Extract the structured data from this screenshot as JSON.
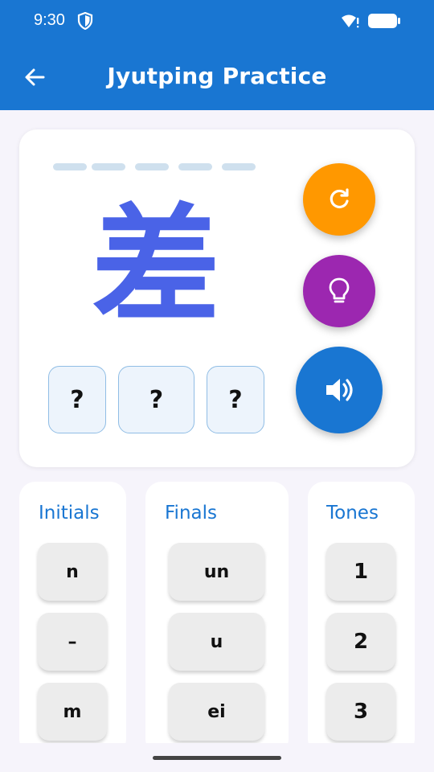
{
  "status_bar": {
    "time": "9:30",
    "icons": [
      "shield-icon",
      "wifi-icon",
      "battery-icon"
    ]
  },
  "app_bar": {
    "title": "Jyutping Practice",
    "back_icon": "arrow-left-icon",
    "color": "#1976d2"
  },
  "practice_card": {
    "character": "差",
    "character_color": "#4a63e7",
    "progress_dash_count": 5,
    "answer_slots": [
      "?",
      "?",
      "?"
    ],
    "actions": [
      {
        "name": "refresh",
        "icon": "refresh-icon",
        "color": "#ff9800"
      },
      {
        "name": "hint",
        "icon": "lightbulb-icon",
        "color": "#9c27b0"
      },
      {
        "name": "play-sound",
        "icon": "speaker-icon",
        "color": "#1976d2"
      }
    ]
  },
  "initials": {
    "title": "Initials",
    "options": [
      "n",
      "–",
      "m"
    ]
  },
  "finals": {
    "title": "Finals",
    "options": [
      "un",
      "u",
      "ei"
    ]
  },
  "tones": {
    "title": "Tones",
    "options": [
      "1",
      "2",
      "3"
    ]
  }
}
